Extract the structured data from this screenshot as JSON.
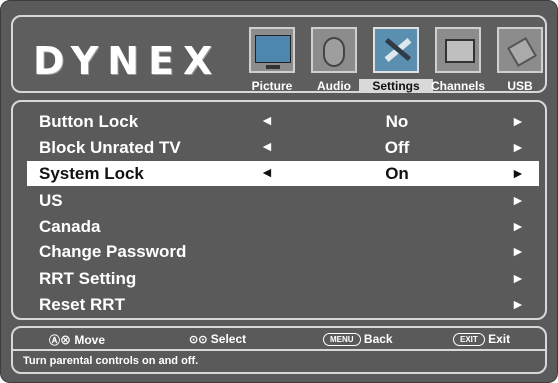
{
  "brand": {
    "logo": "DYNEX"
  },
  "tabs": [
    {
      "label": "Picture",
      "icon": "tv-picture-icon"
    },
    {
      "label": "Audio",
      "icon": "speaker-icon"
    },
    {
      "label": "Settings",
      "icon": "tools-icon",
      "active": true
    },
    {
      "label": "Channels",
      "icon": "channels-tv-icon"
    },
    {
      "label": "USB",
      "icon": "usb-icon"
    }
  ],
  "menu": {
    "rows": [
      {
        "name": "Button Lock",
        "value": "No",
        "left_arrow": "◄",
        "right_arrow": "►"
      },
      {
        "name": "Block Unrated TV",
        "value": "Off",
        "left_arrow": "◄",
        "right_arrow": "►"
      },
      {
        "name": "System Lock",
        "value": "On",
        "left_arrow": "◄",
        "right_arrow": "►",
        "selected": true
      },
      {
        "name": "US",
        "value": "",
        "left_arrow": "",
        "right_arrow": "►"
      },
      {
        "name": "Canada",
        "value": "",
        "left_arrow": "",
        "right_arrow": "►"
      },
      {
        "name": "Change Password",
        "value": "",
        "left_arrow": "",
        "right_arrow": "►"
      },
      {
        "name": "RRT Setting",
        "value": "",
        "left_arrow": "",
        "right_arrow": "►"
      },
      {
        "name": "Reset RRT",
        "value": "",
        "left_arrow": "",
        "right_arrow": "►"
      }
    ]
  },
  "footer": {
    "move_glyph": "Ⓐ⊗",
    "move_label": "Move",
    "select_glyph": "⊙⊙",
    "select_label": "Select",
    "menu_pill": "MENU",
    "back_label": "Back",
    "exit_pill": "EXIT",
    "exit_label": "Exit",
    "help_text": "Turn parental controls on and off."
  },
  "colors": {
    "background": "#5a5a5a",
    "border": "#d8d8d8",
    "selected_row": "#ffffff",
    "text": "#ffffff"
  }
}
